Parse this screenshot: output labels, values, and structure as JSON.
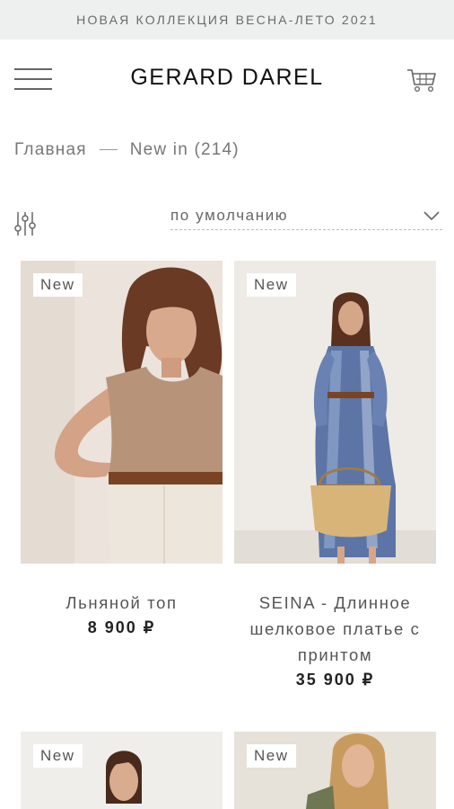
{
  "promo_banner": "НОВАЯ КОЛЛЕКЦИЯ ВЕСНА-ЛЕТО 2021",
  "header": {
    "brand": "GERARD DAREL"
  },
  "breadcrumb": {
    "home": "Главная",
    "current": "New in (214)"
  },
  "sort": {
    "selected": "по умолчанию"
  },
  "products": [
    {
      "badge": "New",
      "name": "Льняной топ",
      "price": "8 900 ₽"
    },
    {
      "badge": "New",
      "name": "SEINA - Длинное шелковое платье с принтом",
      "price": "35 900 ₽"
    },
    {
      "badge": "New",
      "name": "",
      "price": ""
    },
    {
      "badge": "New",
      "name": "",
      "price": ""
    }
  ],
  "colors": {
    "banner_bg": "#eef0f0",
    "text": "#555555",
    "brand": "#111111"
  },
  "icons": [
    "menu-icon",
    "cart-icon",
    "filter-icon",
    "chevron-down-icon"
  ]
}
